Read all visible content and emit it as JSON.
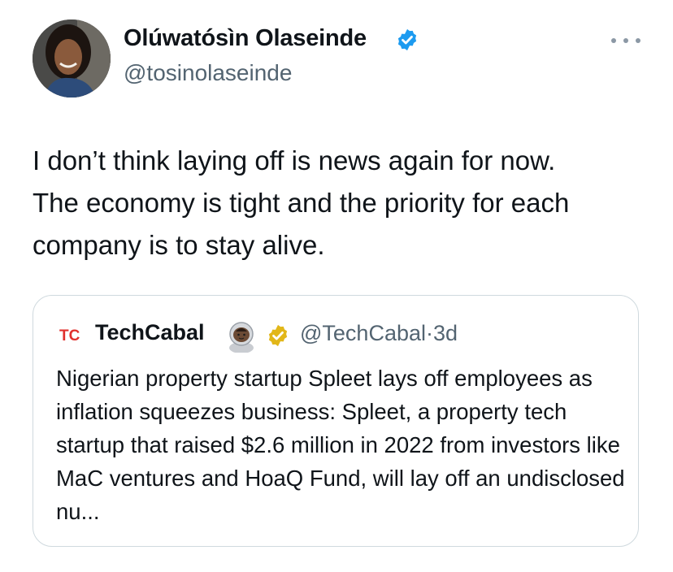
{
  "author": {
    "display_name": "Olúwatósìn Olaseinde",
    "handle": "@tosinolaseinde",
    "verified": true,
    "verified_color": "#1d9bf0"
  },
  "more_icon": "more-horizontal-icon",
  "tweet": {
    "text": "I don’t think laying off is news again for now.\nThe economy is tight and the priority for each\ncompany is to stay alive."
  },
  "quote": {
    "logo_text": "TC",
    "display_name": "TechCabal",
    "emoji": "astronaut-emoji",
    "verified_color": "#e2b719",
    "handle": "@TechCabal",
    "separator": "·",
    "time": "3d",
    "text": "Nigerian property startup Spleet lays off employees as inflation squeezes business: Spleet, a property tech startup that raised $2.6 million in 2022 from investors like MaC ventures and HoaQ Fund, will lay off an undisclosed nu..."
  }
}
